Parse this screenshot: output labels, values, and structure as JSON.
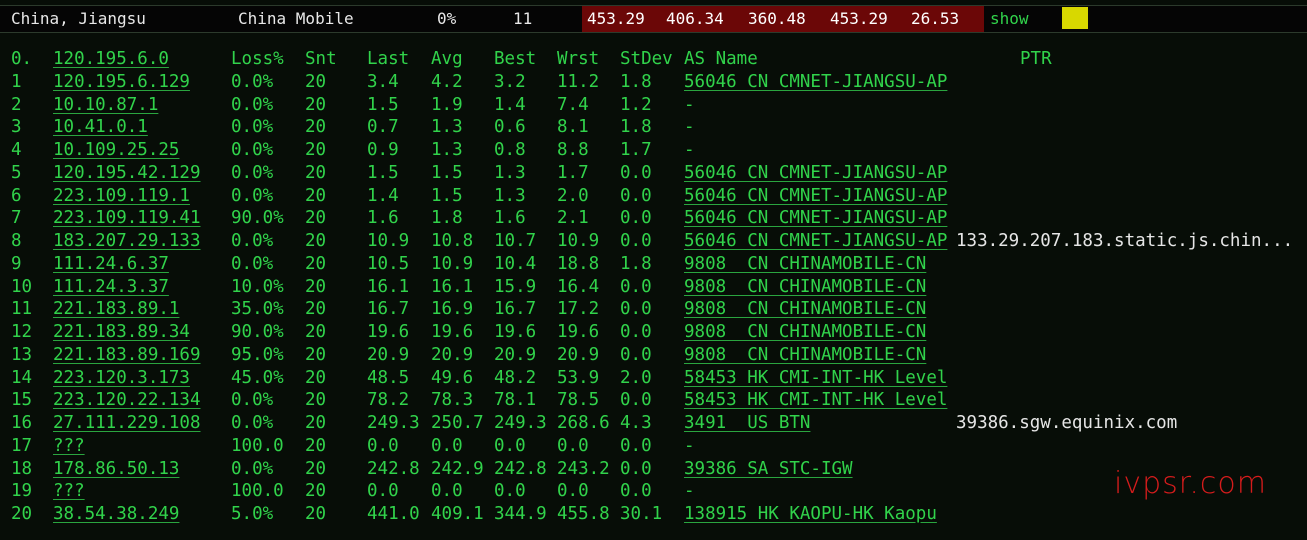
{
  "topbar": {
    "location": "China, Jiangsu",
    "isp": "China Mobile",
    "loss": "0%",
    "count": "11",
    "latencies": [
      "453.29",
      "406.34",
      "360.48",
      "453.29",
      "26.53"
    ],
    "show_label": "show"
  },
  "colors": {
    "text_green": "#31d34b",
    "ptr_white": "#e6e6e6",
    "band_red": "#6b0707",
    "flag_yellow": "#d8d800",
    "background": "#070d07",
    "watermark_red": "#d61c1c"
  },
  "table": {
    "headers": {
      "no": "0.",
      "host": "120.195.6.0",
      "loss": "Loss%",
      "snt": "Snt",
      "last": "Last",
      "avg": "Avg",
      "best": "Best",
      "wrst": "Wrst",
      "stdev": "StDev",
      "as": "AS Name",
      "ptr": "PTR"
    },
    "rows": [
      {
        "no": "1",
        "host": "120.195.6.129",
        "loss": "0.0%",
        "snt": "20",
        "last": "3.4",
        "avg": "4.2",
        "best": "3.2",
        "wrst": "11.2",
        "stdev": "1.8",
        "as": "56046 CN CMNET-JIANGSU-AP",
        "ptr": ""
      },
      {
        "no": "2",
        "host": "10.10.87.1",
        "loss": "0.0%",
        "snt": "20",
        "last": "1.5",
        "avg": "1.9",
        "best": "1.4",
        "wrst": "7.4",
        "stdev": "1.2",
        "as": "-",
        "ptr": ""
      },
      {
        "no": "3",
        "host": "10.41.0.1",
        "loss": "0.0%",
        "snt": "20",
        "last": "0.7",
        "avg": "1.3",
        "best": "0.6",
        "wrst": "8.1",
        "stdev": "1.8",
        "as": "-",
        "ptr": ""
      },
      {
        "no": "4",
        "host": "10.109.25.25",
        "loss": "0.0%",
        "snt": "20",
        "last": "0.9",
        "avg": "1.3",
        "best": "0.8",
        "wrst": "8.8",
        "stdev": "1.7",
        "as": "-",
        "ptr": ""
      },
      {
        "no": "5",
        "host": "120.195.42.129",
        "loss": "0.0%",
        "snt": "20",
        "last": "1.5",
        "avg": "1.5",
        "best": "1.3",
        "wrst": "1.7",
        "stdev": "0.0",
        "as": "56046 CN CMNET-JIANGSU-AP",
        "ptr": ""
      },
      {
        "no": "6",
        "host": "223.109.119.1",
        "loss": "0.0%",
        "snt": "20",
        "last": "1.4",
        "avg": "1.5",
        "best": "1.3",
        "wrst": "2.0",
        "stdev": "0.0",
        "as": "56046 CN CMNET-JIANGSU-AP",
        "ptr": ""
      },
      {
        "no": "7",
        "host": "223.109.119.41",
        "loss": "90.0%",
        "snt": "20",
        "last": "1.6",
        "avg": "1.8",
        "best": "1.6",
        "wrst": "2.1",
        "stdev": "0.0",
        "as": "56046 CN CMNET-JIANGSU-AP",
        "ptr": ""
      },
      {
        "no": "8",
        "host": "183.207.29.133",
        "loss": "0.0%",
        "snt": "20",
        "last": "10.9",
        "avg": "10.8",
        "best": "10.7",
        "wrst": "10.9",
        "stdev": "0.0",
        "as": "56046 CN CMNET-JIANGSU-AP",
        "ptr": "133.29.207.183.static.js.chin..."
      },
      {
        "no": "9",
        "host": "111.24.6.37",
        "loss": "0.0%",
        "snt": "20",
        "last": "10.5",
        "avg": "10.9",
        "best": "10.4",
        "wrst": "18.8",
        "stdev": "1.8",
        "as": "9808  CN CHINAMOBILE-CN",
        "ptr": ""
      },
      {
        "no": "10",
        "host": "111.24.3.37",
        "loss": "10.0%",
        "snt": "20",
        "last": "16.1",
        "avg": "16.1",
        "best": "15.9",
        "wrst": "16.4",
        "stdev": "0.0",
        "as": "9808  CN CHINAMOBILE-CN",
        "ptr": ""
      },
      {
        "no": "11",
        "host": "221.183.89.1",
        "loss": "35.0%",
        "snt": "20",
        "last": "16.7",
        "avg": "16.9",
        "best": "16.7",
        "wrst": "17.2",
        "stdev": "0.0",
        "as": "9808  CN CHINAMOBILE-CN",
        "ptr": ""
      },
      {
        "no": "12",
        "host": "221.183.89.34",
        "loss": "90.0%",
        "snt": "20",
        "last": "19.6",
        "avg": "19.6",
        "best": "19.6",
        "wrst": "19.6",
        "stdev": "0.0",
        "as": "9808  CN CHINAMOBILE-CN",
        "ptr": ""
      },
      {
        "no": "13",
        "host": "221.183.89.169",
        "loss": "95.0%",
        "snt": "20",
        "last": "20.9",
        "avg": "20.9",
        "best": "20.9",
        "wrst": "20.9",
        "stdev": "0.0",
        "as": "9808  CN CHINAMOBILE-CN",
        "ptr": ""
      },
      {
        "no": "14",
        "host": "223.120.3.173",
        "loss": "45.0%",
        "snt": "20",
        "last": "48.5",
        "avg": "49.6",
        "best": "48.2",
        "wrst": "53.9",
        "stdev": "2.0",
        "as": "58453 HK CMI-INT-HK Level",
        "ptr": ""
      },
      {
        "no": "15",
        "host": "223.120.22.134",
        "loss": "0.0%",
        "snt": "20",
        "last": "78.2",
        "avg": "78.3",
        "best": "78.1",
        "wrst": "78.5",
        "stdev": "0.0",
        "as": "58453 HK CMI-INT-HK Level",
        "ptr": ""
      },
      {
        "no": "16",
        "host": "27.111.229.108",
        "loss": "0.0%",
        "snt": "20",
        "last": "249.3",
        "avg": "250.7",
        "best": "249.3",
        "wrst": "268.6",
        "stdev": "4.3",
        "as": "3491  US BTN",
        "ptr": "39386.sgw.equinix.com"
      },
      {
        "no": "17",
        "host": "???",
        "loss": "100.0",
        "snt": "20",
        "last": "0.0",
        "avg": "0.0",
        "best": "0.0",
        "wrst": "0.0",
        "stdev": "0.0",
        "as": "-",
        "ptr": ""
      },
      {
        "no": "18",
        "host": "178.86.50.13",
        "loss": "0.0%",
        "snt": "20",
        "last": "242.8",
        "avg": "242.9",
        "best": "242.8",
        "wrst": "243.2",
        "stdev": "0.0",
        "as": "39386 SA STC-IGW",
        "ptr": ""
      },
      {
        "no": "19",
        "host": "???",
        "loss": "100.0",
        "snt": "20",
        "last": "0.0",
        "avg": "0.0",
        "best": "0.0",
        "wrst": "0.0",
        "stdev": "0.0",
        "as": "-",
        "ptr": ""
      },
      {
        "no": "20",
        "host": "38.54.38.249",
        "loss": "5.0%",
        "snt": "20",
        "last": "441.0",
        "avg": "409.1",
        "best": "344.9",
        "wrst": "455.8",
        "stdev": "30.1",
        "as": "138915 HK KAOPU-HK Kaopu",
        "ptr": ""
      }
    ]
  },
  "watermark": "ivpsr.com"
}
